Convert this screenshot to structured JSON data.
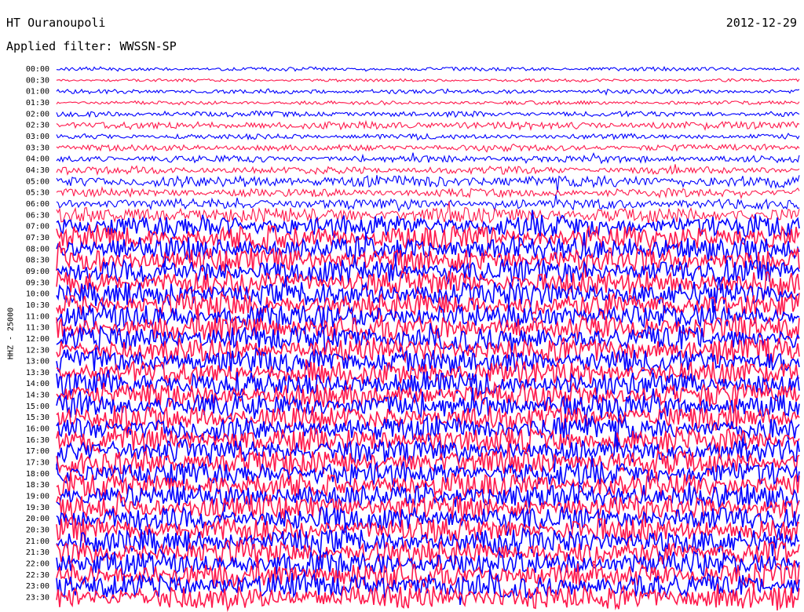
{
  "header": {
    "station": "HT Ouranoupoli",
    "date": "2012-12-29",
    "filter": "Applied filter: WWSSN-SP"
  },
  "chart_data": {
    "type": "line",
    "title": "HT Ouranoupoli",
    "ylabel": "HHZ - 25000",
    "colors": [
      "#0000ff",
      "#ff1a4d"
    ],
    "traces": [
      {
        "time": "00:00",
        "color": "#0000ff",
        "level": 0.1
      },
      {
        "time": "00:30",
        "color": "#ff1a4d",
        "level": 0.06
      },
      {
        "time": "01:00",
        "color": "#0000ff",
        "level": 0.12
      },
      {
        "time": "01:30",
        "color": "#ff1a4d",
        "level": 0.1
      },
      {
        "time": "02:00",
        "color": "#0000ff",
        "level": 0.18
      },
      {
        "time": "02:30",
        "color": "#ff1a4d",
        "level": 0.28
      },
      {
        "time": "03:00",
        "color": "#0000ff",
        "level": 0.16
      },
      {
        "time": "03:30",
        "color": "#ff1a4d",
        "level": 0.22
      },
      {
        "time": "04:00",
        "color": "#0000ff",
        "level": 0.24
      },
      {
        "time": "04:30",
        "color": "#ff1a4d",
        "level": 0.26
      },
      {
        "time": "05:00",
        "color": "#0000ff",
        "level": 0.45
      },
      {
        "time": "05:30",
        "color": "#ff1a4d",
        "level": 0.3
      },
      {
        "time": "06:00",
        "color": "#0000ff",
        "level": 0.4
      },
      {
        "time": "06:30",
        "color": "#ff1a4d",
        "level": 0.6
      },
      {
        "time": "07:00",
        "color": "#0000ff",
        "level": 0.9
      },
      {
        "time": "07:30",
        "color": "#ff1a4d",
        "level": 1.0
      },
      {
        "time": "08:00",
        "color": "#0000ff",
        "level": 1.0
      },
      {
        "time": "08:30",
        "color": "#ff1a4d",
        "level": 1.0
      },
      {
        "time": "09:00",
        "color": "#0000ff",
        "level": 1.0
      },
      {
        "time": "09:30",
        "color": "#ff1a4d",
        "level": 1.0
      },
      {
        "time": "10:00",
        "color": "#0000ff",
        "level": 1.0
      },
      {
        "time": "10:30",
        "color": "#ff1a4d",
        "level": 1.0
      },
      {
        "time": "11:00",
        "color": "#0000ff",
        "level": 1.0
      },
      {
        "time": "11:30",
        "color": "#ff1a4d",
        "level": 1.0
      },
      {
        "time": "12:00",
        "color": "#0000ff",
        "level": 1.0
      },
      {
        "time": "12:30",
        "color": "#ff1a4d",
        "level": 1.0
      },
      {
        "time": "13:00",
        "color": "#0000ff",
        "level": 1.0
      },
      {
        "time": "13:30",
        "color": "#ff1a4d",
        "level": 1.0
      },
      {
        "time": "14:00",
        "color": "#0000ff",
        "level": 1.0
      },
      {
        "time": "14:30",
        "color": "#ff1a4d",
        "level": 1.0
      },
      {
        "time": "15:00",
        "color": "#0000ff",
        "level": 1.0
      },
      {
        "time": "15:30",
        "color": "#ff1a4d",
        "level": 1.0
      },
      {
        "time": "16:00",
        "color": "#0000ff",
        "level": 1.0
      },
      {
        "time": "16:30",
        "color": "#ff1a4d",
        "level": 1.0
      },
      {
        "time": "17:00",
        "color": "#0000ff",
        "level": 1.0
      },
      {
        "time": "17:30",
        "color": "#ff1a4d",
        "level": 1.0
      },
      {
        "time": "18:00",
        "color": "#0000ff",
        "level": 1.0
      },
      {
        "time": "18:30",
        "color": "#ff1a4d",
        "level": 1.0
      },
      {
        "time": "19:00",
        "color": "#0000ff",
        "level": 1.0
      },
      {
        "time": "19:30",
        "color": "#ff1a4d",
        "level": 1.0
      },
      {
        "time": "20:00",
        "color": "#0000ff",
        "level": 1.0
      },
      {
        "time": "20:30",
        "color": "#ff1a4d",
        "level": 1.0
      },
      {
        "time": "21:00",
        "color": "#0000ff",
        "level": 1.0
      },
      {
        "time": "21:30",
        "color": "#ff1a4d",
        "level": 1.0
      },
      {
        "time": "22:00",
        "color": "#0000ff",
        "level": 1.0
      },
      {
        "time": "22:30",
        "color": "#ff1a4d",
        "level": 1.0
      },
      {
        "time": "23:00",
        "color": "#0000ff",
        "level": 1.0
      },
      {
        "time": "23:30",
        "color": "#ff1a4d",
        "level": 1.0
      }
    ]
  }
}
